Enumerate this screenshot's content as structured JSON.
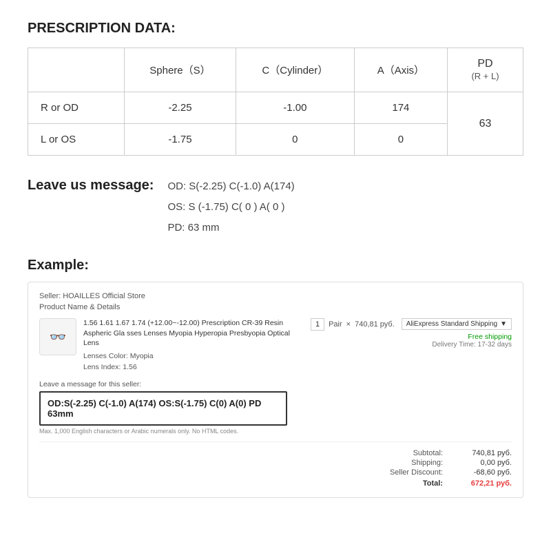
{
  "prescription": {
    "title": "PRESCRIPTION DATA:",
    "columns": {
      "sphere": "Sphere（S）",
      "cylinder": "C（Cylinder）",
      "axis": "A（Axis）",
      "pd_label": "PD",
      "pd_sub": "(R + L)"
    },
    "rows": [
      {
        "label": "R or OD",
        "sphere": "-2.25",
        "cylinder": "-1.00",
        "axis": "174"
      },
      {
        "label": "L or OS",
        "sphere": "-1.75",
        "cylinder": "0",
        "axis": "0"
      }
    ],
    "pd_value": "63"
  },
  "message_section": {
    "label": "Leave us message:",
    "lines": [
      "OD:  S(-2.25)    C(-1.0)   A(174)",
      "OS:  S (-1.75)    C( 0 )    A( 0 )",
      "PD:  63 mm"
    ]
  },
  "example": {
    "title": "Example:",
    "seller": "Seller: HOAILLES Official Store",
    "product_label": "Product Name & Details",
    "product_name": "1.56 1.61 1.67 1.74 (+12.00~-12.00) Prescription CR-39 Resin Aspheric Gla sses Lenses Myopia Hyperopia Presbyopia Optical Lens",
    "lens_color_label": "Lenses Color:",
    "lens_color": "Myopia",
    "lens_index_label": "Lens Index:",
    "lens_index": "1.56",
    "qty": "1",
    "qty_unit": "Pair",
    "multiply": "×",
    "price": "740,81 руб.",
    "shipping_option": "AliExpress Standard Shipping",
    "free_shipping": "Free shipping",
    "delivery_time": "Delivery Time: 17-32 days",
    "message_box_label": "Leave a message for this seller:",
    "message_box_value": "OD:S(-2.25) C(-1.0) A(174)   OS:S(-1.75) C(0) A(0)  PD 63mm",
    "message_box_hint": "Max. 1,000 English characters or Arabic numerals only. No HTML codes.",
    "totals": {
      "subtotal_label": "Subtotal:",
      "subtotal_value": "740,81 руб.",
      "shipping_label": "Shipping:",
      "shipping_value": "0,00 руб.",
      "discount_label": "Seller Discount:",
      "discount_value": "-68,60 руб.",
      "total_label": "Total:",
      "total_value": "672,21 руб."
    }
  }
}
